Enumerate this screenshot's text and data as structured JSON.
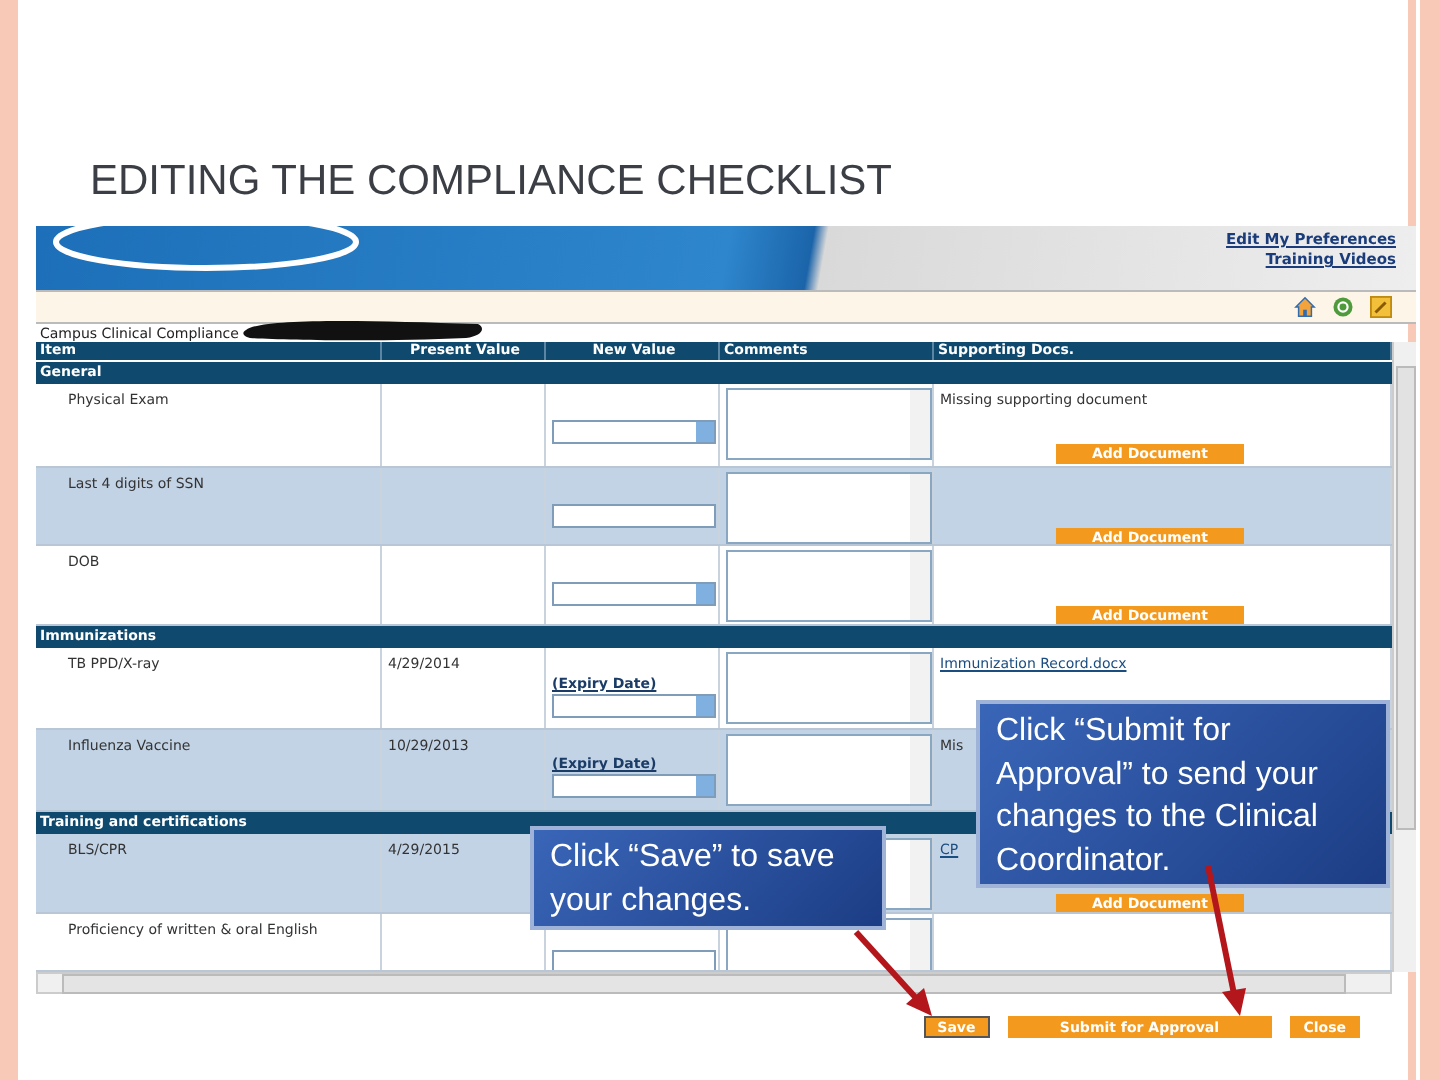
{
  "slide": {
    "title": "EDITING THE COMPLIANCE CHECKLIST"
  },
  "header": {
    "links": [
      "Edit My Preferences",
      "Training Videos"
    ]
  },
  "page_label": "Campus Clinical Compliance",
  "columns": [
    "Item",
    "Present Value",
    "New Value",
    "Comments",
    "Supporting Docs."
  ],
  "sections": [
    {
      "name": "General",
      "rows": [
        {
          "item": "Physical Exam",
          "new_value": {
            "kind": "select"
          },
          "note": "Missing supporting document",
          "add_button": "Add Document",
          "highlighted": false
        },
        {
          "item": "Last 4 digits of SSN",
          "new_value": {
            "kind": "text"
          },
          "add_button": "Add Document",
          "highlighted": true
        },
        {
          "item": "DOB",
          "new_value": {
            "kind": "select"
          },
          "add_button": "Add Document",
          "highlighted": false
        }
      ]
    },
    {
      "name": "Immunizations",
      "rows": [
        {
          "item": "TB PPD/X-ray",
          "present": "4/29/2014",
          "new_value": {
            "kind": "select"
          },
          "field_label": "(Expiry Date)",
          "link": "Immunization Record.docx",
          "highlighted": false
        },
        {
          "item": "Influenza Vaccine",
          "present": "10/29/2013",
          "new_value": {
            "kind": "select"
          },
          "field_label": "(Expiry Date)",
          "note": "Mis",
          "highlighted": true
        }
      ]
    },
    {
      "name": "Training and certifications",
      "rows": [
        {
          "item": "BLS/CPR",
          "present": "4/29/2015",
          "link": "CP",
          "add_button": "Add Document",
          "highlighted": true
        },
        {
          "item": "Proficiency of written & oral English",
          "new_value": {
            "kind": "text"
          },
          "highlighted": false
        }
      ]
    }
  ],
  "buttons": [
    {
      "label": "Save",
      "focused": true
    },
    {
      "label": "Submit for Approval",
      "focused": false
    },
    {
      "label": "Close",
      "focused": false
    }
  ],
  "callouts": [
    "Click “Save” to save your changes.",
    "Click “Submit for Approval” to send your changes to the Clinical Coordinator."
  ]
}
